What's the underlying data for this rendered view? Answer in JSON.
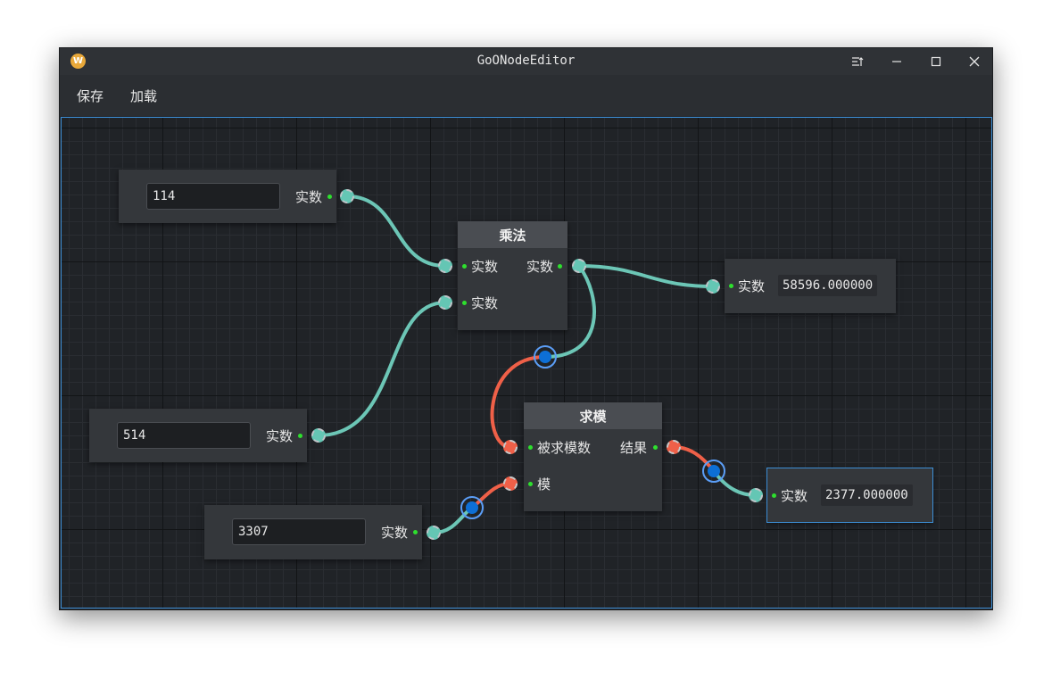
{
  "window": {
    "title": "GoONodeEditor",
    "logo_letter": "W"
  },
  "menu": {
    "save": "保存",
    "load": "加载"
  },
  "nodes": {
    "input1": {
      "value": "114",
      "out_label": "实数"
    },
    "input2": {
      "value": "514",
      "out_label": "实数"
    },
    "input3": {
      "value": "3307",
      "out_label": "实数"
    },
    "multiply": {
      "title": "乘法",
      "in1": "实数",
      "in2": "实数",
      "out": "实数"
    },
    "modulo": {
      "title": "求模",
      "in1": "被求模数",
      "in2": "模",
      "out": "结果"
    },
    "display1": {
      "in_label": "实数",
      "value": "58596.000000"
    },
    "display2": {
      "in_label": "实数",
      "value": "2377.000000"
    }
  },
  "colors": {
    "teal_wire": "#6cc6b6",
    "red_wire": "#ef6048",
    "pin_green": "#2ee02e",
    "selection_blue": "#3d8fd6",
    "reroute_blue": "#0d6fd6"
  }
}
